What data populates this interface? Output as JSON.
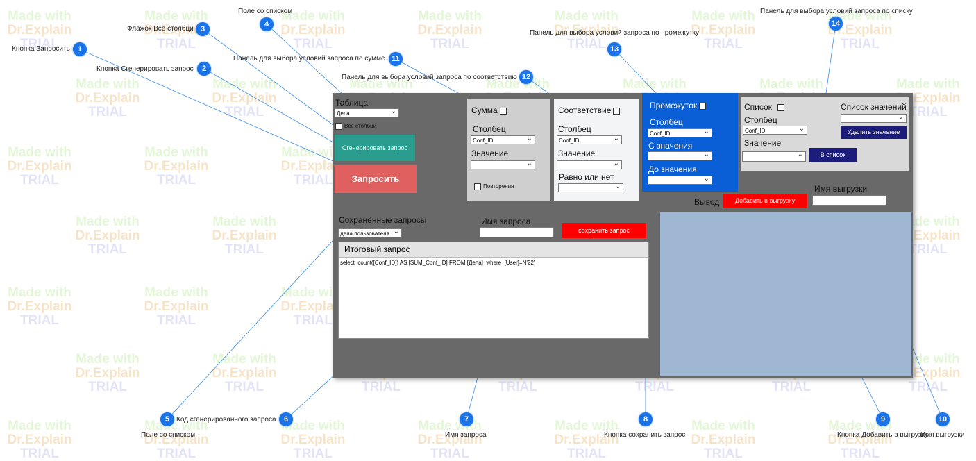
{
  "watermark": {
    "line1": "Made with",
    "line2": "Dr.Explain",
    "line3": "TRIAL"
  },
  "callouts": [
    {
      "num": "1",
      "label": "Кнопка Запросить"
    },
    {
      "num": "2",
      "label": "Кнопка Сгенерировать запрос"
    },
    {
      "num": "3",
      "label": "Флажок Все столбци"
    },
    {
      "num": "4",
      "label": "Поле со списком"
    },
    {
      "num": "5",
      "label": "Поле со списком"
    },
    {
      "num": "6",
      "label": "Код сгенерированного запроса"
    },
    {
      "num": "7",
      "label": "Имя запроса"
    },
    {
      "num": "8",
      "label": "Кнопка сохранить запрос"
    },
    {
      "num": "9",
      "label": "Кнопка Добавить в выгрузку"
    },
    {
      "num": "10",
      "label": "Имя выгрузки"
    },
    {
      "num": "11",
      "label": "Панель для выбора условий запроса по сумме"
    },
    {
      "num": "12",
      "label": "Панель для выбора условий запроса по соответствию"
    },
    {
      "num": "13",
      "label": "Панель для выбора условий запроса по промежутку"
    },
    {
      "num": "14",
      "label": "Панель для выбора условий запроса по списку"
    }
  ],
  "app": {
    "table": {
      "label": "Таблица",
      "value": "Дела",
      "all_columns_label": "Все столбци"
    },
    "generate_button": "Сгенерировать запрос",
    "request_button": "Запросить",
    "sum_panel": {
      "title": "Сумма",
      "column_label": "Столбец",
      "column_value": "Conf_ID",
      "value_label": "Значение",
      "repeat_label": "Повторения"
    },
    "match_panel": {
      "title": "Соответствие",
      "column_label": "Столбец",
      "column_value": "Conf_ID",
      "value_label": "Значение",
      "equal_label": "Равно или нет"
    },
    "range_panel": {
      "title": "Промежуток",
      "column_label": "Столбец",
      "column_value": "Conf_ID",
      "from_label": "С значения",
      "to_label": "До значения"
    },
    "list_panel": {
      "title": "Список",
      "column_label": "Столбец",
      "column_value": "Conf_ID",
      "value_label": "Значение",
      "list_values_label": "Список значений",
      "delete_button": "Удалить значение",
      "to_list_button": "В список"
    },
    "export_name_label": "Имя выгрузки",
    "output_label": "Вывод",
    "add_export_button": "Добавить в выгрузку",
    "saved_queries": {
      "label": "Сохранённые запросы",
      "value": "дела пользователя"
    },
    "query_name_label": "Имя запроса",
    "save_query_button": "сохранить запрос",
    "result_query": {
      "title": "Итоговый запрос",
      "code": "select  count([Conf_ID]) AS [SUM_Conf_ID] FROM [Дела]  where  [User]=N'22'"
    }
  },
  "colors": {
    "callout": "#1a73e8",
    "app_bg": "#696969",
    "range_panel": "#0a5fd6",
    "generate_btn": "#2a9d8f",
    "request_btn": "#e06060",
    "red_btn": "#ff0000",
    "navy_btn": "#1c1c7a",
    "output_area": "#9fb7d3"
  }
}
